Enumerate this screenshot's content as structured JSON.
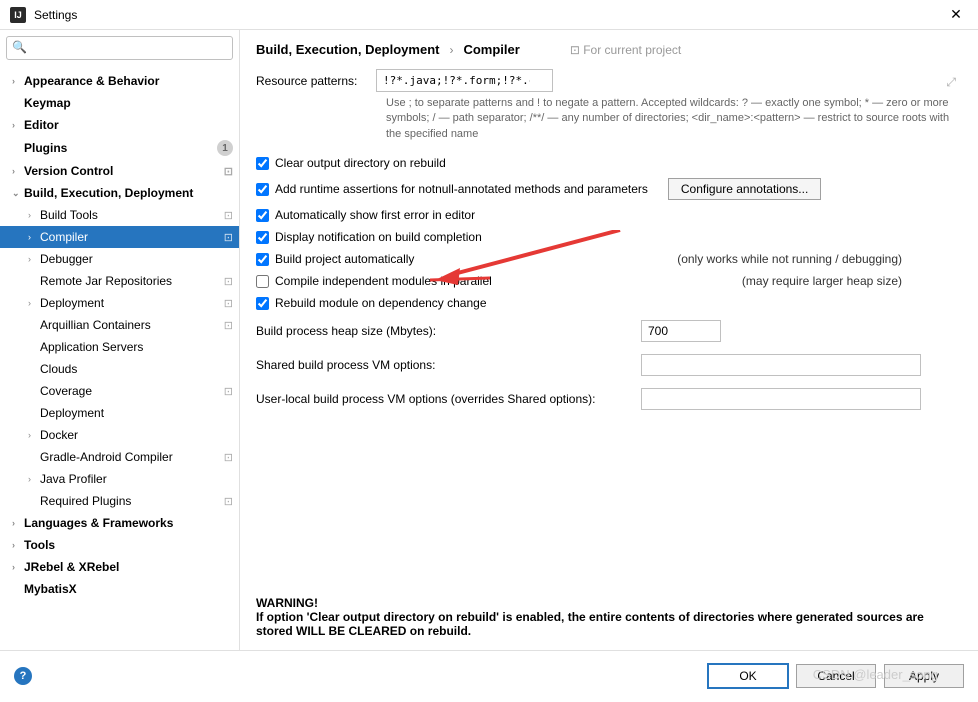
{
  "window": {
    "title": "Settings",
    "close": "✕"
  },
  "search": {
    "placeholder": ""
  },
  "nav": {
    "appearance": "Appearance & Behavior",
    "keymap": "Keymap",
    "editor": "Editor",
    "plugins": "Plugins",
    "plugins_badge": "1",
    "version_control": "Version Control",
    "bed": "Build, Execution, Deployment",
    "build_tools": "Build Tools",
    "compiler": "Compiler",
    "debugger": "Debugger",
    "remote_jar": "Remote Jar Repositories",
    "deployment": "Deployment",
    "arquillian": "Arquillian Containers",
    "app_servers": "Application Servers",
    "clouds": "Clouds",
    "coverage": "Coverage",
    "deployment2": "Deployment",
    "docker": "Docker",
    "gradle_android": "Gradle-Android Compiler",
    "java_profiler": "Java Profiler",
    "required_plugins": "Required Plugins",
    "lang_fw": "Languages & Frameworks",
    "tools": "Tools",
    "jrebel": "JRebel & XRebel",
    "mybatisx": "MybatisX",
    "proj_marker": "⊡"
  },
  "breadcrumb": {
    "parent": "Build, Execution, Deployment",
    "current": "Compiler",
    "hint": "⊡ For current project"
  },
  "form": {
    "resource_patterns_label": "Resource patterns:",
    "resource_patterns_value": "!?*.java;!?*.form;!?*.class;!?*.groovy;!?*.scala;!?*.flex;!?*.kt;!?*.clj;!?*.aj",
    "resource_help": "Use ; to separate patterns and ! to negate a pattern. Accepted wildcards: ? — exactly one symbol; * — zero or more symbols; / — path separator; /**/ — any number of directories; <dir_name>:<pattern> — restrict to source roots with the specified name",
    "clear_output": "Clear output directory on rebuild",
    "add_runtime": "Add runtime assertions for notnull-annotated methods and parameters",
    "configure_btn": "Configure annotations...",
    "auto_first_error": "Automatically show first error in editor",
    "display_notif": "Display notification on build completion",
    "build_auto": "Build project automatically",
    "build_auto_note": "(only works while not running / debugging)",
    "compile_parallel": "Compile independent modules in parallel",
    "compile_parallel_note": "(may require larger heap size)",
    "rebuild_module": "Rebuild module on dependency change",
    "heap_label": "Build process heap size (Mbytes):",
    "heap_value": "700",
    "shared_vm_label": "Shared build process VM options:",
    "shared_vm_value": "",
    "user_vm_label": "User-local build process VM options (overrides Shared options):",
    "user_vm_value": ""
  },
  "warning": {
    "title": "WARNING!",
    "text": "If option 'Clear output directory on rebuild' is enabled, the entire contents of directories where generated sources are stored WILL BE CLEARED on rebuild."
  },
  "footer": {
    "ok": "OK",
    "cancel": "Cancel",
    "apply": "Apply"
  },
  "watermark": "CSDN @leader_song"
}
